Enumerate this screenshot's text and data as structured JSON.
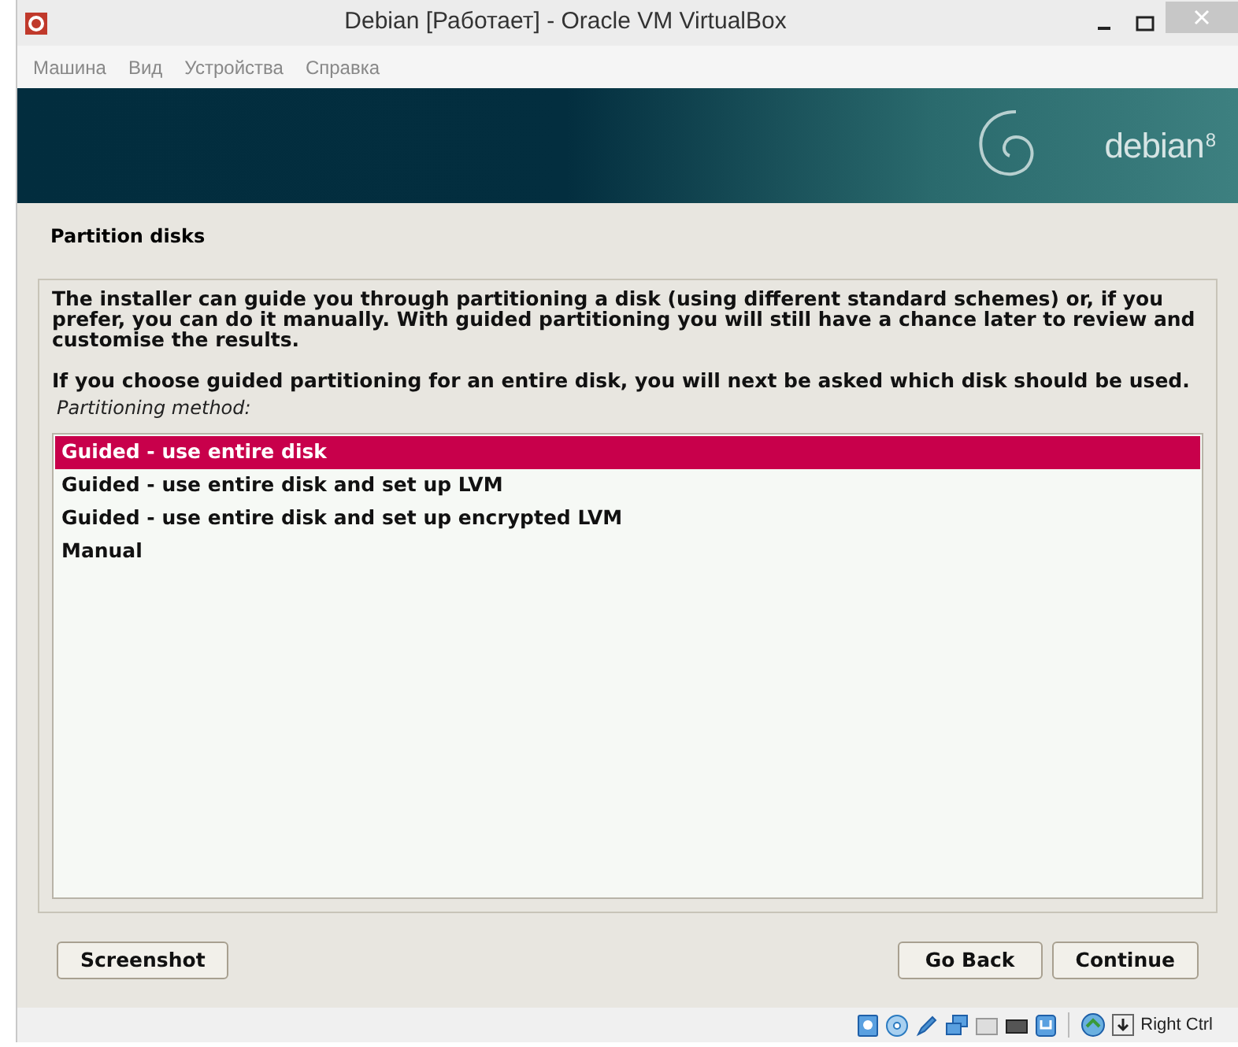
{
  "window": {
    "title": "Debian [Работает] - Oracle VM VirtualBox"
  },
  "menu": [
    "Машина",
    "Вид",
    "Устройства",
    "Справка"
  ],
  "banner": {
    "logo": "debian",
    "version": "8"
  },
  "installer": {
    "title": "Partition disks",
    "paragraphs": [
      "The installer can guide you through partitioning a disk (using different standard schemes) or, if you prefer, you can do it manually. With guided partitioning you will still have a chance later to review and customise the results.",
      "If you choose guided partitioning for an entire disk, you will next be asked which disk should be used."
    ],
    "prompt": "Partitioning method:",
    "options": [
      {
        "label": "Guided - use entire disk",
        "selected": true
      },
      {
        "label": "Guided - use entire disk and set up LVM",
        "selected": false
      },
      {
        "label": "Guided - use entire disk and set up encrypted LVM",
        "selected": false
      },
      {
        "label": "Manual",
        "selected": false
      }
    ],
    "buttons": {
      "left": [
        "Screenshot"
      ],
      "right": [
        "Go Back",
        "Continue"
      ]
    }
  },
  "status_bar": {
    "host_key": "Right Ctrl"
  }
}
